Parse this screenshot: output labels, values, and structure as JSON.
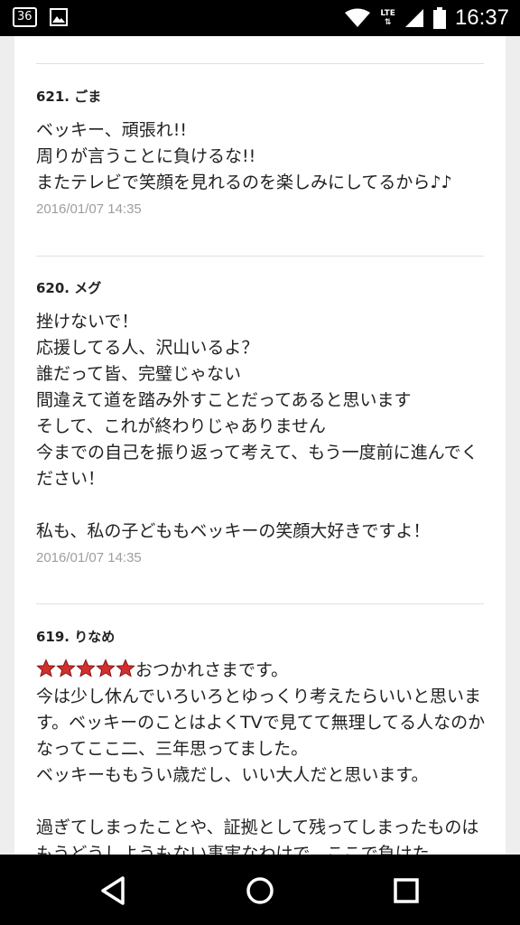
{
  "status_bar": {
    "notification_count": "36",
    "network": "LTE",
    "time": "16:37"
  },
  "comments": [
    {
      "number": "621.",
      "author": "ごま",
      "body": "ベッキー、頑張れ!!\n周りが言うことに負けるな!!\nまたテレビで笑顔を見れるのを楽しみにしてるから♪♪",
      "date": "2016/01/07 14:35"
    },
    {
      "number": "620.",
      "author": "メグ",
      "body": "挫けないで！\n応援してる人、沢山いるよ？\n誰だって皆、完璧じゃない\n間違えて道を踏み外すことだってあると思います\nそして、これが終わりじゃありません\n今までの自己を振り返って考えて、もう一度前に進んでください！\n\n私も、私の子どももベッキーの笑顔大好きですよ！",
      "date": "2016/01/07 14:35"
    },
    {
      "number": "619.",
      "author": "りなめ",
      "stars": 5,
      "body_first": "おつかれさまです。",
      "body": "今は少し休んでいろいろとゆっくり考えたらいいと思います。ベッキーのことはよくTVで見てて無理してる人なのかなってここ二、三年思ってました。\nベッキーももうい歳だし、いい大人だと思います。\n\n過ぎてしまったことや、証拠として残ってしまったものはもうどうしようもない事実なわけで、ここで負けた"
    }
  ],
  "nav": {
    "back": "back-icon",
    "home": "home-icon",
    "recents": "recents-icon"
  },
  "colors": {
    "star_fill": "#d32f2f",
    "date_text": "#9e9e9e",
    "card_bg": "#ffffff",
    "page_bg": "#eeeeee"
  }
}
